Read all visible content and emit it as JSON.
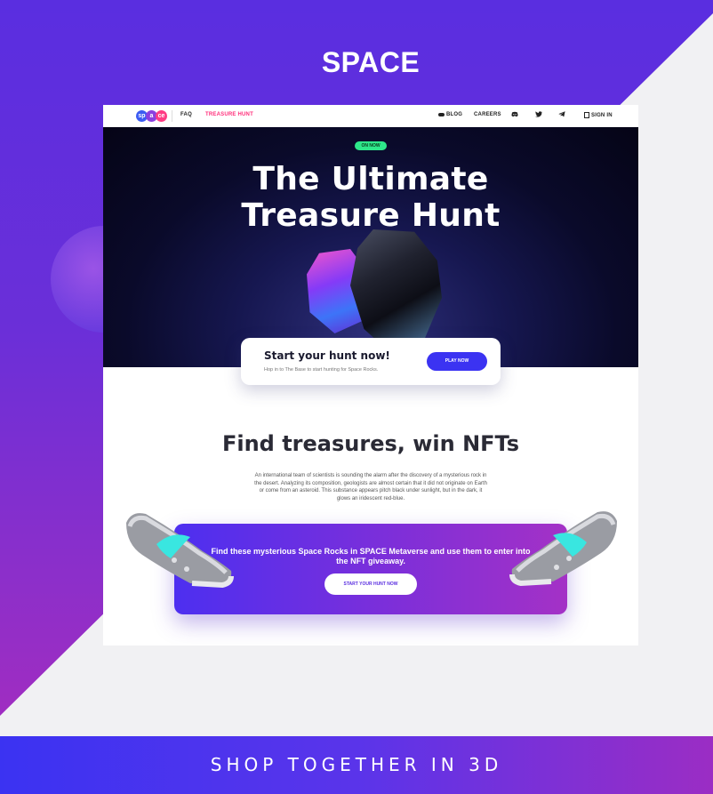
{
  "poster": {
    "title": "SPACE",
    "footer": "SHOP TOGETHER IN 3D"
  },
  "nav": {
    "logo": [
      "sp",
      "a",
      "ce"
    ],
    "faq": "FAQ",
    "treasure_hunt": "TREASURE HUNT",
    "blog": "BLOG",
    "careers": "CAREERS",
    "discord_icon": "discord-icon",
    "twitter_icon": "twitter-icon",
    "telegram_icon": "telegram-icon",
    "sign_in": "SIGN IN"
  },
  "hero": {
    "badge": "ON NOW",
    "title_line1": "The Ultimate",
    "title_line2": "Treasure Hunt"
  },
  "hunt_card": {
    "title": "Start your hunt now!",
    "subtitle": "Hop in to The Base to start hunting for Space Rocks.",
    "button": "PLAY NOW"
  },
  "find": {
    "title": "Find treasures, win NFTs",
    "description": "An international team of scientists is sounding the alarm after the discovery of a mysterious rock in the desert. Analyzing its composition, geologists are almost certain that it did not originate on Earth or come from an asteroid. This substance appears pitch black under sunlight, but in the dark, it glows an iridescent red-blue."
  },
  "promo": {
    "text": "Find these mysterious Space Rocks in SPACE Metaverse and use them to enter into the NFT giveaway.",
    "button": "START YOUR HUNT NOW"
  },
  "colors": {
    "accent_blue": "#3b33f2",
    "accent_pink": "#ff2e7a",
    "badge_green": "#2ee88a",
    "purple": "#7d2fd9"
  }
}
